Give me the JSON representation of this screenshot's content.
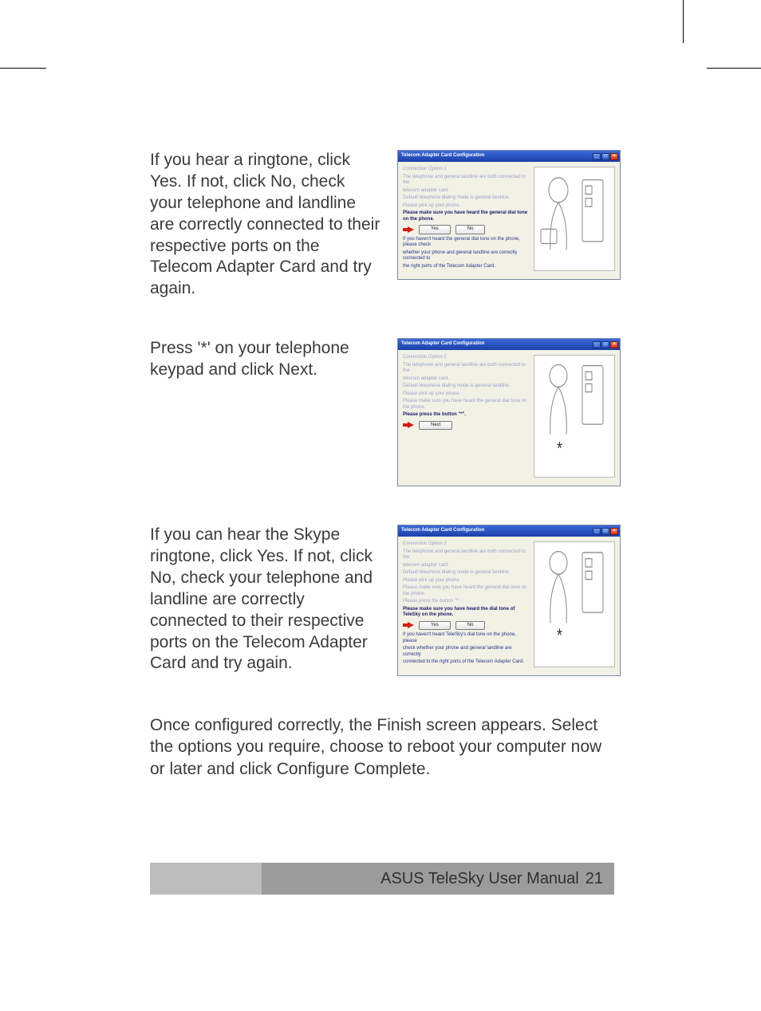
{
  "trim_marks": true,
  "steps": [
    {
      "text": "If you hear a ringtone, click Yes. If not, click No, check your telephone and landline are correctly connected to their respective ports on the Telecom Adapter Card and try again.",
      "dialog": {
        "title": "Telecom Adapter Card Configuration",
        "heading": "Connection Option 2",
        "faded_lines": [
          "The telephone and general landline are both connected to the",
          "telecom adapter card.",
          "Default telephone dialing mode is general landline.",
          "Please pick up your phone."
        ],
        "strong_line": "Please make sure you have heard the general dial tone on the phone.",
        "buttons": [
          "Yes",
          "No"
        ],
        "post_lines": [
          "If you haven't heard the general dial tone on the phone, please check",
          "whether your phone and general landline are correctly connected to",
          "the right ports of the Telecom Adapter Card."
        ],
        "asterisk": false
      }
    },
    {
      "text": "Press '*' on your telephone keypad and click Next.",
      "dialog": {
        "title": "Telecom Adapter Card Configuration",
        "heading": "Connection Option 2",
        "faded_lines": [
          "The telephone and general landline are both connected to the",
          "telecom adapter card.",
          "Default telephone dialing mode is general landline.",
          "Please pick up your phone.",
          "Please make sure you have heard the general dial tone on the phone."
        ],
        "strong_line": "Please press the button \"*\".",
        "buttons": [
          "Next"
        ],
        "post_lines": [],
        "asterisk": true
      }
    },
    {
      "text": "If you can hear the Skype ringtone, click Yes. If not, click No, check your telephone and landline are correctly connected to their respective ports on the Telecom Adapter Card and try again.",
      "dialog": {
        "title": "Telecom Adapter Card Configuration",
        "heading": "Connection Option 2",
        "faded_lines": [
          "The telephone and general landline are both connected to the",
          "telecom adapter card.",
          "Default telephone dialing mode is general landline.",
          "Please pick up your phone.",
          "Please make sure you have heard the general dial tone on the phone.",
          "Please press the button \"*\"."
        ],
        "strong_line": "Please make sure you have heard the dial tone of TeleSky on the phone.",
        "buttons": [
          "Yes",
          "No"
        ],
        "post_lines": [
          "If you haven't heard TeleSky's dial tone on the phone, please",
          "check whether your phone and general landline are correctly",
          "connected to the right ports of the Telecom Adapter Card."
        ],
        "asterisk": true
      }
    }
  ],
  "after_paragraph": "Once configured correctly, the Finish screen appears. Select the options you require, choose to reboot your computer now or later and click Configure Complete.",
  "footer": {
    "title": "ASUS TeleSky User Manual",
    "page": "21"
  },
  "window_buttons": {
    "min": "_",
    "max": "□",
    "close": "×"
  }
}
